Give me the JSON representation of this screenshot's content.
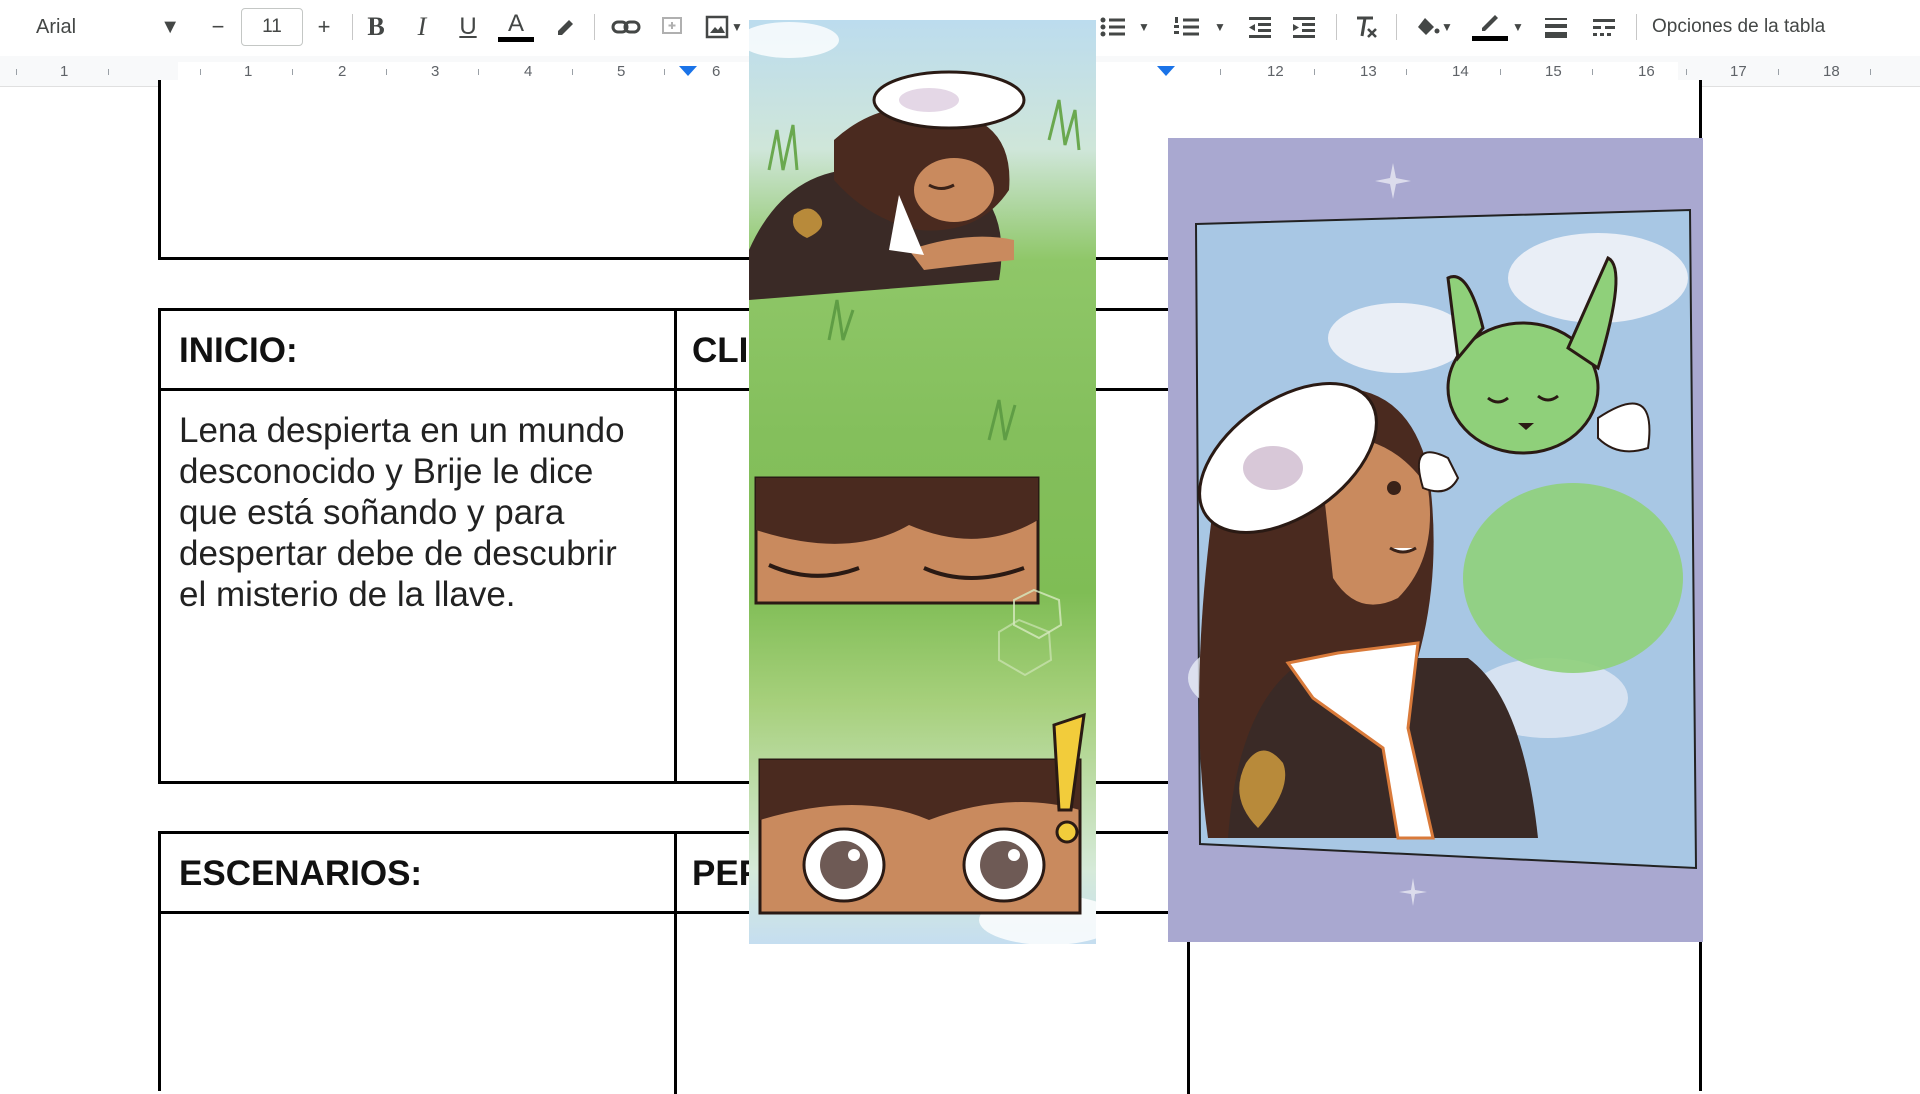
{
  "toolbar": {
    "font_name": "Arial",
    "font_size": "11",
    "minus": "−",
    "plus": "+",
    "bold": "B",
    "italic": "I",
    "underline": "U",
    "text_color": "A",
    "table_options": "Opciones de la tabla"
  },
  "ruler": {
    "numbers": [
      "1",
      "1",
      "2",
      "3",
      "4",
      "5",
      "6",
      "12",
      "13",
      "14",
      "15",
      "16",
      "17",
      "18"
    ]
  },
  "document": {
    "inicio_heading": "INICIO:",
    "climax_heading_partial": "CLI",
    "inicio_text_lines": [
      "Lena despierta en un mundo",
      "desconocido y Brije le dice",
      "que está soñando y para",
      "despertar debe de descubrir",
      "el misterio de la llave."
    ],
    "escenarios_heading": "ESCENARIOS:",
    "personajes_heading_partial": "PEF"
  },
  "colors": {
    "accent_blue": "#1a73e8",
    "grass_green": "#84bf5c",
    "lavender": "#a9a8d0",
    "sky_blue": "#b9d3e9"
  }
}
